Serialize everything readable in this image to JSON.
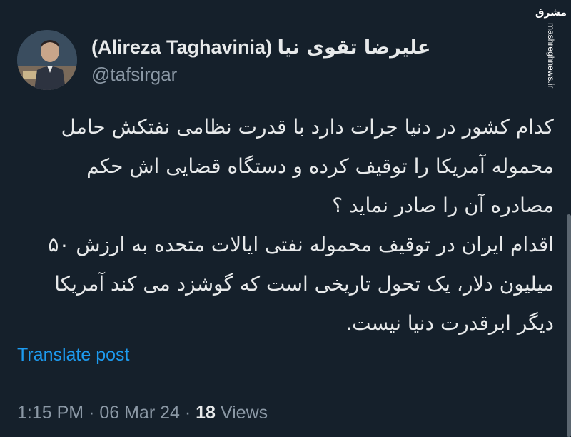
{
  "tweet": {
    "author": {
      "display_name_latin": "(Alireza Taghavinia)",
      "display_name_persian": "علیرضا تقوی نیا",
      "handle": "@tafsirgar",
      "avatar": "avatar-photo"
    },
    "paragraphs": [
      "کدام کشور در دنیا جرات دارد با قدرت نظامی نفتکش حامل محموله آمریکا را توقیف کرده و دستگاه قضایی اش حکم مصادره آن را صادر نماید ؟",
      "اقدام ایران در توقیف محموله نفتی ایالات متحده به ارزش ۵۰ میلیون دلار، یک تحول تاریخی است که گوشزد می کند آمریکا دیگر ابرقدرت دنیا نیست."
    ],
    "translate_label": "Translate post",
    "time": "1:15 PM",
    "separator": "·",
    "date": "06 Mar 24",
    "views_count": "18",
    "views_label": "Views"
  },
  "watermark": {
    "logo_text": "مشرق",
    "site": "mashreghnews.ir"
  },
  "colors": {
    "background": "#15202b",
    "text": "#e7e9ea",
    "muted": "#8b98a5",
    "link": "#1d9bf0"
  }
}
